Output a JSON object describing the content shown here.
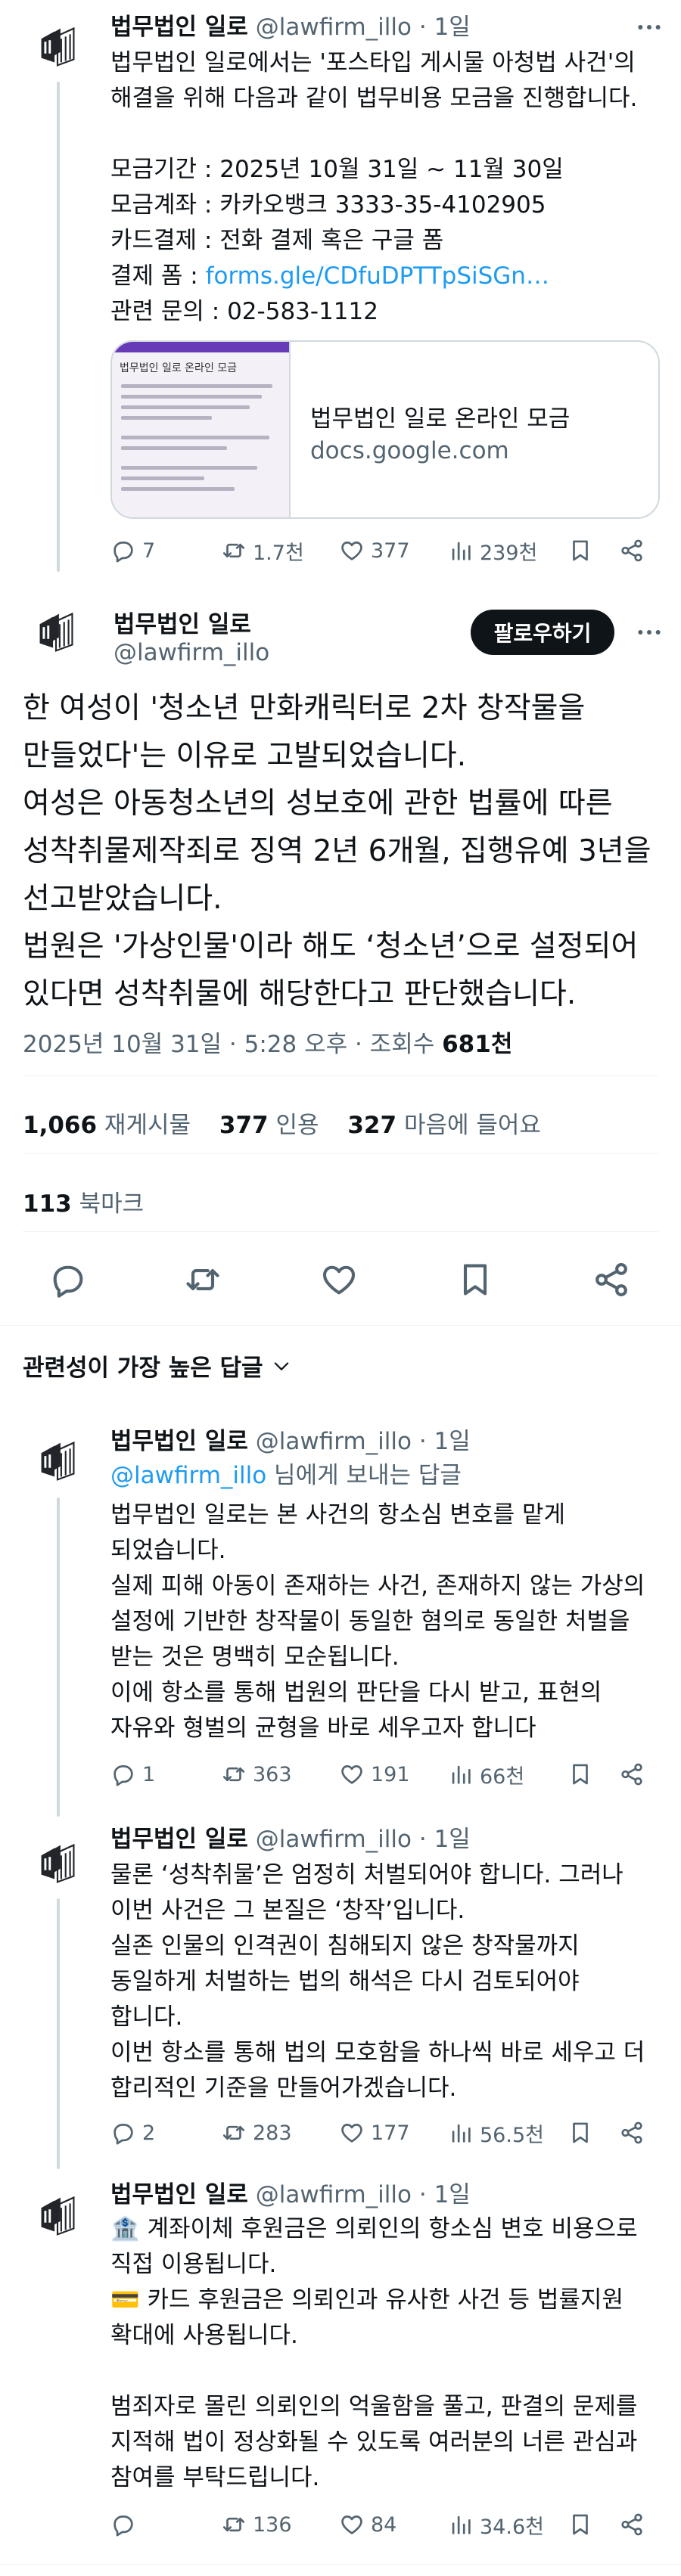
{
  "author": {
    "name": "법무법인 일로",
    "handle": "@lawfirm_illo"
  },
  "tweet1": {
    "time": "1일",
    "lines": [
      "법무법인 일로에서는 '포스타입 게시물 아청법 사건'의",
      "해결을 위해 다음과 같이 법무비용 모금을 진행합니다.",
      "",
      "모금기간 : 2025년 10월 31일 ~ 11월 30일",
      "모금계좌 : 카카오뱅크 3333-35-4102905",
      "카드결제 : 전화 결제 혹은 구글 폼"
    ],
    "form_label": "결제 폼 : ",
    "form_link": "forms.gle/CDfuDPTTpSiSGn…",
    "contact": "관련 문의 : 02-583-1112",
    "card": {
      "thumb_title": "법무법인 일로 온라인 모금",
      "title": "법무법인 일로 온라인 모금",
      "domain": "docs.google.com"
    },
    "replies": "7",
    "retweets": "1.7천",
    "likes": "377",
    "views": "239천"
  },
  "main": {
    "follow_label": "팔로우하기",
    "lines": [
      "한 여성이 '청소년 만화캐릭터로 2차 창작물을",
      "만들었다'는 이유로 고발되었습니다.",
      "여성은 아동청소년의 성보호에 관한 법률에 따른",
      "성착취물제작죄로 징역 2년 6개월, 집행유예 3년을",
      "선고받았습니다.",
      "법원은 '가상인물'이라 해도 ‘청소년’으로 설정되어",
      "있다면 성착취물에 해당한다고 판단했습니다."
    ],
    "timestamp": "2025년 10월 31일 · 5:28 오후 · 조회수 ",
    "views": "681천",
    "retweets_count": "1,066",
    "retweets_label": "재게시물",
    "quotes_count": "377",
    "quotes_label": "인용",
    "likes_count": "327",
    "likes_label": "마음에 들어요",
    "bookmarks_count": "113",
    "bookmarks_label": "북마크"
  },
  "sort_label": "관련성이 가장 높은 답글",
  "reply1": {
    "time": "1일",
    "reply_to_handle": "@lawfirm_illo",
    "reply_to_suffix": " 님에게 보내는 답글",
    "lines": [
      "법무법인 일로는 본 사건의 항소심 변호를 맡게",
      "되었습니다.",
      "실제 피해 아동이 존재하는 사건, 존재하지 않는 가상의",
      "설정에 기반한 창작물이 동일한 혐의로 동일한 처벌을",
      "받는 것은 명백히 모순됩니다.",
      "이에 항소를 통해 법원의 판단을 다시 받고, 표현의",
      "자유와 형벌의 균형을 바로 세우고자 합니다"
    ],
    "replies": "1",
    "retweets": "363",
    "likes": "191",
    "views": "66천"
  },
  "reply2": {
    "time": "1일",
    "lines": [
      "물론 ‘성착취물’은 엄정히 처벌되어야 합니다. 그러나",
      "이번 사건은 그 본질은 ‘창작’입니다.",
      "실존 인물의 인격권이 침해되지 않은 창작물까지",
      "동일하게 처벌하는 법의 해석은 다시 검토되어야",
      "합니다.",
      "이번 항소를 통해 법의 모호함을 하나씩 바로 세우고 더",
      "합리적인 기준을 만들어가겠습니다."
    ],
    "replies": "2",
    "retweets": "283",
    "likes": "177",
    "views": "56.5천"
  },
  "reply3": {
    "time": "1일",
    "lines": [
      "🏦 계좌이체 후원금은 의뢰인의 항소심 변호 비용으로",
      "직접 이용됩니다.",
      "💳 카드 후원금은 의뢰인과 유사한 사건 등 법률지원",
      "확대에 사용됩니다.",
      "",
      "범죄자로 몰린 의뢰인의 억울함을 풀고, 판결의 문제를",
      "지적해 법이 정상화될 수 있도록 여러분의 너른 관심과",
      "참여를 부탁드립니다."
    ],
    "retweets": "136",
    "likes": "84",
    "views": "34.6천"
  },
  "icons": {
    "reply": "speech-bubble-icon",
    "retweet": "repost-arrows-icon",
    "like": "heart-icon",
    "views": "bar-chart-icon",
    "bookmark": "bookmark-icon",
    "share": "share-icon",
    "more": "more-dots-icon",
    "chevron": "chevron-down-icon"
  },
  "colors": {
    "link": "#1d9bf0",
    "secondary_text": "#536471",
    "primary_text": "#0f1419",
    "thread_line": "#cfd9de",
    "follow_button": "#0f1419"
  }
}
